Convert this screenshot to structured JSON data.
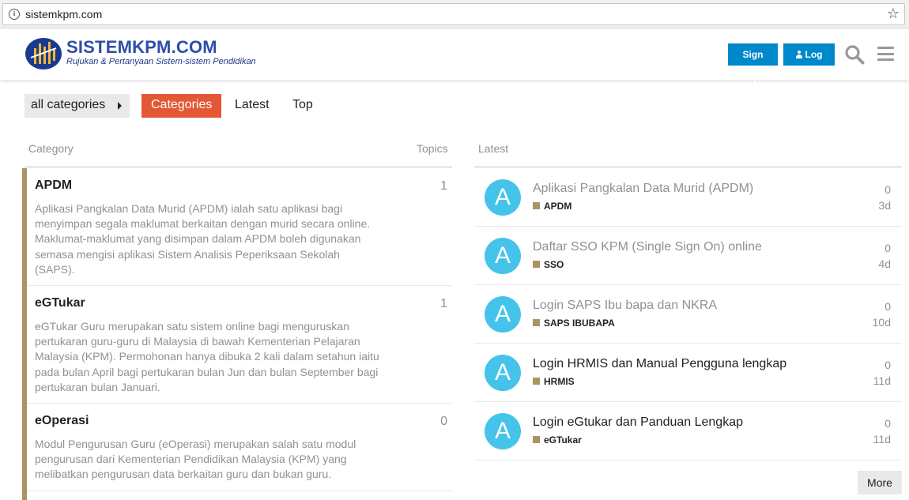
{
  "browser": {
    "url": "sistemkpm.com"
  },
  "header": {
    "brand_name": "SISTEMKPM.COM",
    "brand_tagline": "Rujukan & Pertanyaan Sistem-sistem Pendidikan",
    "signup_label": "Sign Up",
    "login_label": "Log In"
  },
  "nav": {
    "category_filter": "all categories",
    "tabs": [
      {
        "label": "Categories",
        "active": true
      },
      {
        "label": "Latest",
        "active": false
      },
      {
        "label": "Top",
        "active": false
      }
    ]
  },
  "categories": {
    "header_category": "Category",
    "header_topics": "Topics",
    "items": [
      {
        "name": "APDM",
        "topics": "1",
        "description": "Aplikasi Pangkalan Data Murid (APDM) ialah satu aplikasi bagi menyimpan segala maklumat berkaitan dengan murid secara online. Maklumat-maklumat yang disimpan dalam APDM boleh digunakan semasa mengisi aplikasi Sistem Analisis Peperiksaan Sekolah (SAPS)."
      },
      {
        "name": "eGTukar",
        "topics": "1",
        "description": "eGTukar Guru merupakan satu sistem online bagi menguruskan pertukaran guru-guru di Malaysia di bawah Kementerian Pelajaran Malaysia (KPM). Permohonan hanya dibuka 2 kali dalam setahun iaitu pada bulan April bagi pertukaran bulan Jun dan bulan September bagi pertukaran bulan Januari."
      },
      {
        "name": "eOperasi",
        "topics": "0",
        "description": "Modul Pengurusan Guru (eOperasi) merupakan salah satu modul pengurusan dari Kementerian Pendidikan Malaysia (KPM) yang melibatkan pengurusan data berkaitan guru dan bukan guru."
      }
    ]
  },
  "latest": {
    "header": "Latest",
    "more_label": "More",
    "topics": [
      {
        "avatar": "A",
        "title": "Aplikasi Pangkalan Data Murid (APDM)",
        "category": "APDM",
        "posts": "0",
        "age": "3d",
        "visited": true
      },
      {
        "avatar": "A",
        "title": "Daftar SSO KPM (Single Sign On) online",
        "category": "SSO",
        "posts": "0",
        "age": "4d",
        "visited": true
      },
      {
        "avatar": "A",
        "title": "Login SAPS Ibu bapa dan NKRA",
        "category": "SAPS IBUBAPA",
        "posts": "0",
        "age": "10d",
        "visited": true
      },
      {
        "avatar": "A",
        "title": "Login HRMIS dan Manual Pengguna lengkap",
        "category": "HRMIS",
        "posts": "0",
        "age": "11d",
        "visited": false
      },
      {
        "avatar": "A",
        "title": "Login eGtukar dan Panduan Lengkap",
        "category": "eGTukar",
        "posts": "0",
        "age": "11d",
        "visited": false
      }
    ]
  },
  "colors": {
    "accent": "#e45735",
    "button_blue": "#0088cc",
    "category_bar": "#ab9364",
    "avatar": "#45c3ea"
  }
}
